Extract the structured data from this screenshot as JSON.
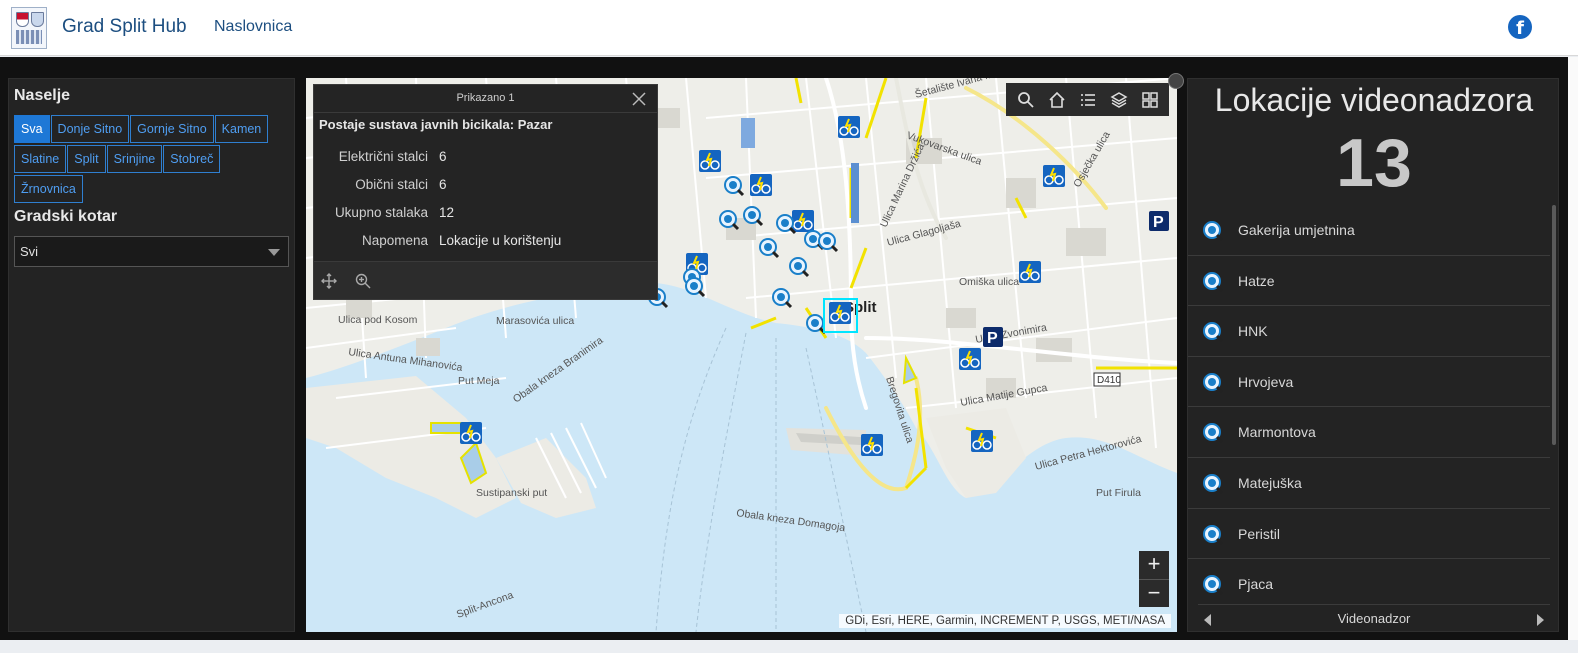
{
  "header": {
    "site_title": "Grad Split Hub",
    "nav_home": "Naslovnica",
    "facebook_icon": "f"
  },
  "filters": {
    "naselje_title": "Naselje",
    "naselje_options": [
      "Sva",
      "Donje Sitno",
      "Gornje Sitno",
      "Kamen",
      "Slatine",
      "Split",
      "Srinjine",
      "Stobreč",
      "Žrnovnica"
    ],
    "naselje_selected": "Sva",
    "kotar_title": "Gradski kotar",
    "kotar_value": "Svi"
  },
  "map": {
    "attribution": "GDi, Esri, HERE, Garmin, INCREMENT P, USGS, METI/NASA",
    "labels": [
      "Split",
      "Ulica pod Kosom",
      "Marasovića ulica",
      "Ulica Antuna Mihanovića",
      "Put Meja",
      "Obala kneza Branimira",
      "Sustipanski put",
      "Obala kneza Domagoja",
      "Ulica Matije Gupca",
      "Ulica Petra Hektorovića",
      "Put Firula",
      "Ulica Glagoljaša",
      "Omiška ulica",
      "Ulica Zvonimira",
      "Bregovita ulica",
      "Osječka ulica",
      "Vukovarska ulica",
      "Ulica Marina Držića",
      "Šetalište Ivana Meštrovića",
      "D410",
      "Split-Ancona"
    ],
    "toolbar_icons": [
      "search-icon",
      "home-icon",
      "list-icon",
      "layers-icon",
      "basemap-gallery-icon"
    ],
    "zoom_in": "+",
    "zoom_out": "−"
  },
  "popup": {
    "count_label": "Prikazano 1",
    "title": "Postaje sustava javnih bicikala: Pazar",
    "fields": [
      {
        "key": "Električni stalci",
        "value": "6"
      },
      {
        "key": "Obični stalci",
        "value": "6"
      },
      {
        "key": "Ukupno stalaka",
        "value": "12"
      },
      {
        "key": "Napomena",
        "value": "Lokacije u korištenju"
      }
    ]
  },
  "panel": {
    "title": "Lokacije videonadzora",
    "count": "13",
    "items": [
      "Gakerija umjetnina",
      "Hatze",
      "HNK",
      "Hrvojeva",
      "Marmontova",
      "Matejuška",
      "Peristil",
      "Pjaca"
    ],
    "footer": "Videonadzor"
  },
  "colors": {
    "accent": "#1e78d6",
    "panel_bg": "#232323",
    "bike_icon": "#1565c0",
    "sea": "#cde7f7"
  }
}
